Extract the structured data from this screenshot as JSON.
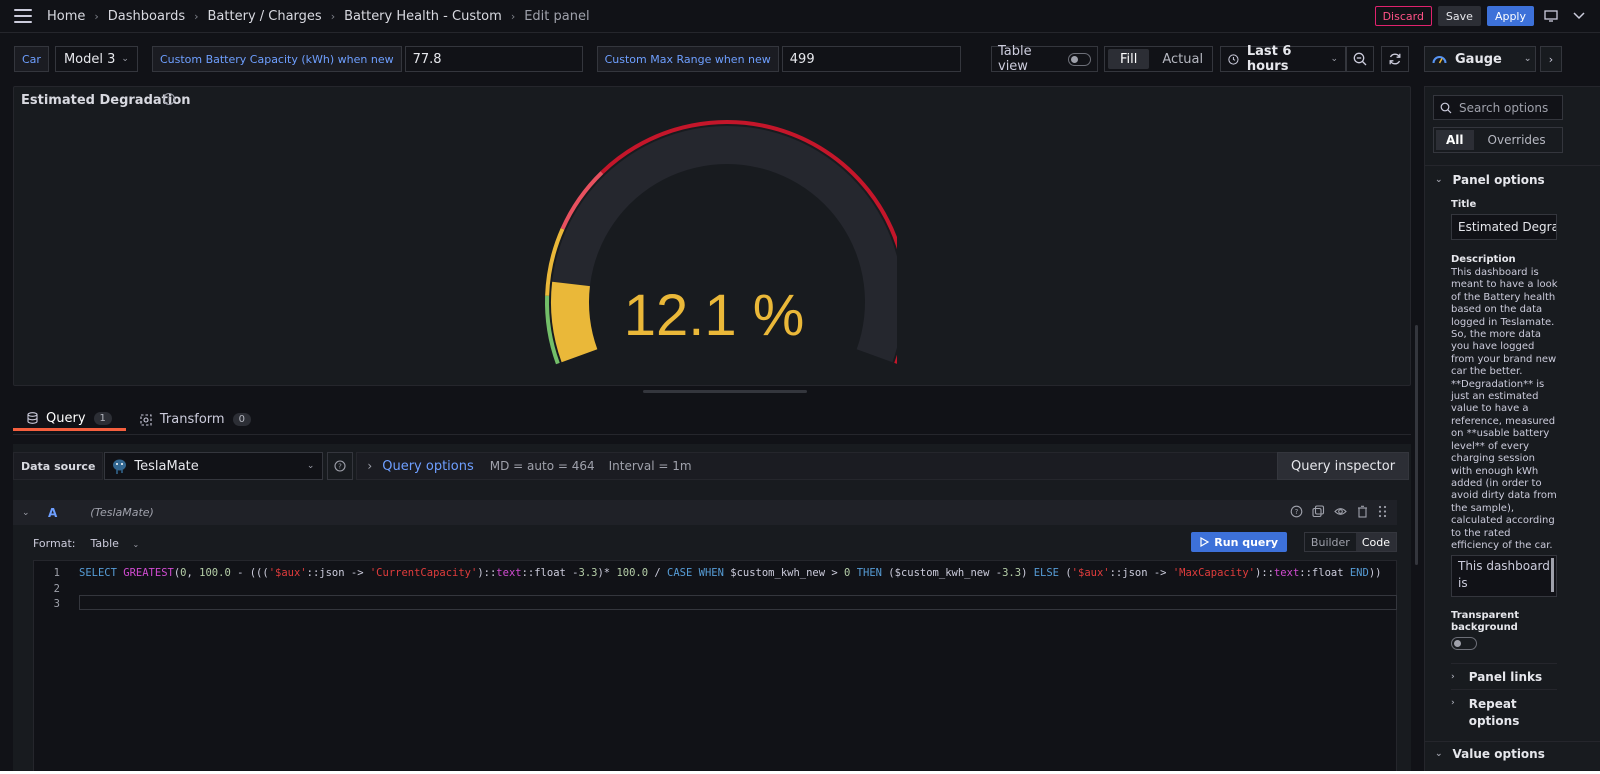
{
  "breadcrumb": [
    "Home",
    "Dashboards",
    "Battery / Charges",
    "Battery Health - Custom",
    "Edit panel"
  ],
  "top_actions": {
    "discard": "Discard",
    "save": "Save",
    "apply": "Apply"
  },
  "variables": {
    "car_label": "Car",
    "car_value": "Model 3",
    "capacity_label": "Custom Battery Capacity (kWh) when new",
    "capacity_value": "77.8",
    "range_label": "Custom Max Range when new",
    "range_value": "499"
  },
  "controls": {
    "table_view": "Table view",
    "fill": "Fill",
    "actual": "Actual",
    "time_range": "Last 6 hours"
  },
  "viz_picker": "Gauge",
  "panel": {
    "title": "Estimated Degradation",
    "value": 12.1,
    "value_text": "12.1 %"
  },
  "tabs": [
    {
      "label": "Query",
      "count": "1"
    },
    {
      "label": "Transform",
      "count": "0"
    }
  ],
  "query": {
    "datasource_label": "Data source",
    "datasource": "TeslaMate",
    "options_link": "Query options",
    "md": "MD = auto = 464",
    "interval": "Interval = 1m",
    "inspector": "Query inspector",
    "ref_id": "A",
    "ds_name": "(TeslaMate)",
    "format_label": "Format:",
    "format_value": "Table",
    "run": "Run query",
    "builder": "Builder",
    "code": "Code",
    "line_numbers": [
      "1",
      "2",
      "3"
    ]
  },
  "sidebar": {
    "search_placeholder": "Search options",
    "all": "All",
    "overrides": "Overrides",
    "panel_options": "Panel options",
    "title_label": "Title",
    "title_value": "Estimated Degradation",
    "description_label": "Description",
    "description": "This dashboard is meant to have a look of the Battery health based on the data logged in Teslamate. So, the more data you have logged from your brand new car the better. **Degradation** is just an estimated value to have a reference, measured on **usable battery level** of every charging session with enough kWh added (in order to avoid dirty data from the sample), calculated according to the rated efficiency of the car.",
    "description_preview": "This dashboard is",
    "transparent_label": "Transparent background",
    "panel_links": "Panel links",
    "repeat_options": "Repeat options",
    "value_options": "Value options"
  },
  "colors": {
    "accent": "#3d71d9",
    "gauge_value": "#eab839",
    "threshold_green": "#73bf69",
    "threshold_yellow": "#eab839",
    "threshold_red": "#e02f44"
  }
}
